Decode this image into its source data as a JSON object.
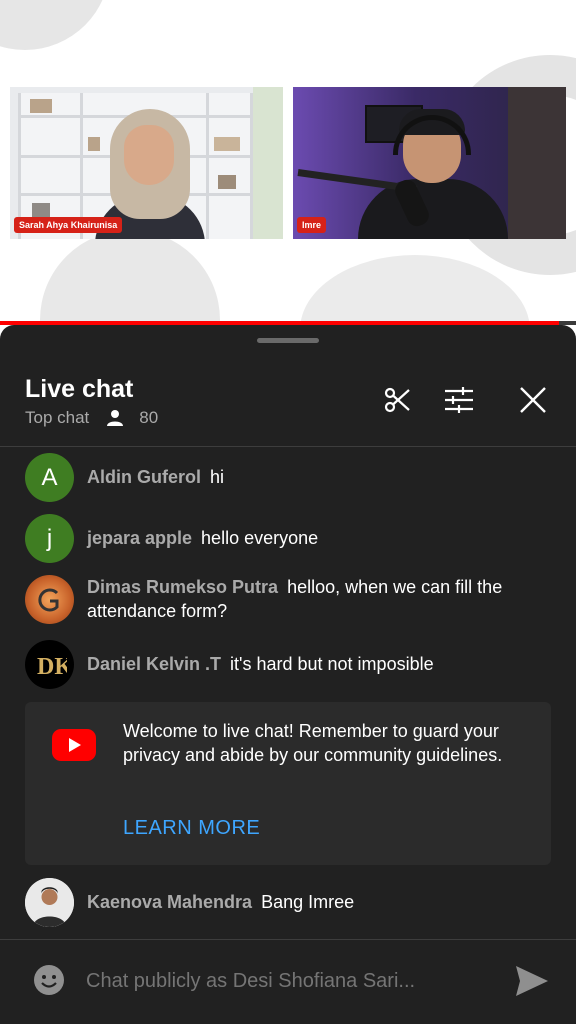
{
  "video": {
    "participants": [
      {
        "name": "Sarah Ahya Khairunisa"
      },
      {
        "name": "Imre"
      }
    ],
    "progress_percent": 97,
    "colors": {
      "progress": "#ff0000",
      "name_tag": "#d62218"
    }
  },
  "chat": {
    "title": "Live chat",
    "mode": "Top chat",
    "viewer_count": "80",
    "header_icons": [
      "scissors-icon",
      "filter-sliders-icon",
      "close-icon"
    ],
    "messages": [
      {
        "avatar_letter": "A",
        "avatar_color": "#3f7d22",
        "author": "Aldin Guferol",
        "text": "hi"
      },
      {
        "avatar_letter": "j",
        "avatar_color": "#3f7d22",
        "author": "jepara apple",
        "text": "hello everyone"
      },
      {
        "avatar_letter": "",
        "avatar_color": "#c8622a",
        "author": "Dimas Rumekso Putra",
        "text": "helloo, when we can fill the attendance form?"
      },
      {
        "avatar_letter": "",
        "avatar_color": "#000000",
        "author": "Daniel Kelvin .T",
        "text": "it's hard but not imposible"
      }
    ],
    "welcome": {
      "text": "Welcome to live chat! Remember to guard your privacy and abide by our community guidelines.",
      "link": "LEARN MORE"
    },
    "last_message": {
      "author": "Kaenova Mahendra",
      "text": "Bang Imree"
    },
    "input": {
      "placeholder": "Chat publicly as Desi Shofiana Sari..."
    },
    "colors": {
      "panel": "#212121",
      "link": "#3ea6ff",
      "author": "#aaaaaa"
    }
  }
}
